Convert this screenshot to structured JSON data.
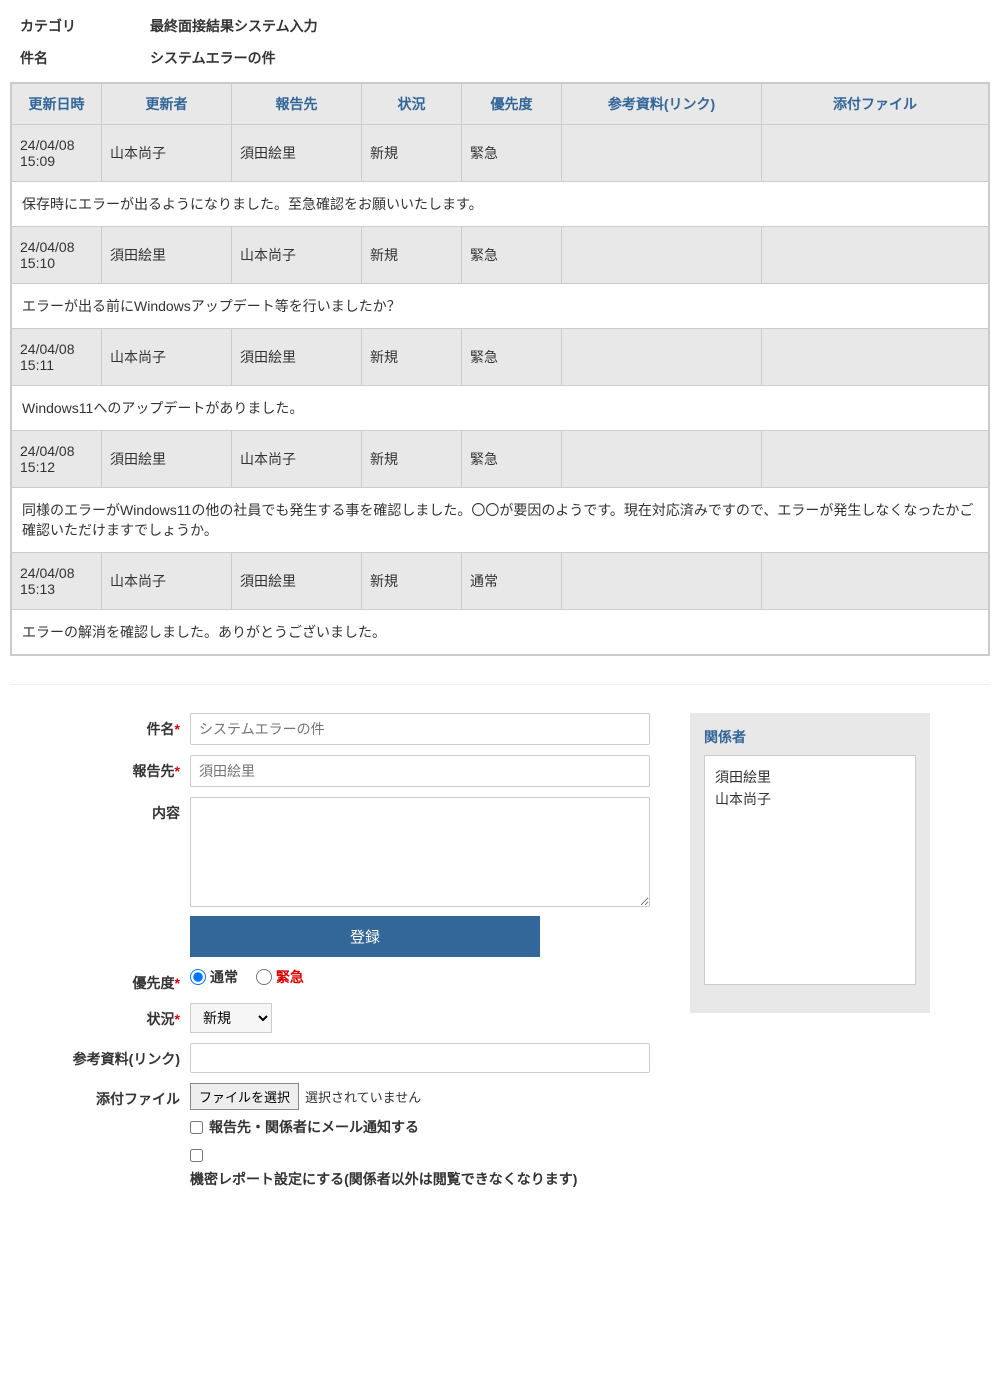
{
  "header": {
    "category_label": "カテゴリ",
    "category_value": "最終面接結果システム入力",
    "subject_label": "件名",
    "subject_value": "システムエラーの件"
  },
  "table": {
    "headers": {
      "date": "更新日時",
      "updater": "更新者",
      "report_to": "報告先",
      "status": "状況",
      "priority": "優先度",
      "reference": "参考資料(リンク)",
      "attachment": "添付ファイル"
    },
    "rows": [
      {
        "date": "24/04/08 15:09",
        "updater": "山本尚子",
        "report_to": "須田絵里",
        "status": "新規",
        "priority": "緊急",
        "reference": "",
        "attachment": "",
        "message": "保存時にエラーが出るようになりました。至急確認をお願いいたします。"
      },
      {
        "date": "24/04/08 15:10",
        "updater": "須田絵里",
        "report_to": "山本尚子",
        "status": "新規",
        "priority": "緊急",
        "reference": "",
        "attachment": "",
        "message": "エラーが出る前にWindowsアップデート等を行いましたか？"
      },
      {
        "date": "24/04/08 15:11",
        "updater": "山本尚子",
        "report_to": "須田絵里",
        "status": "新規",
        "priority": "緊急",
        "reference": "",
        "attachment": "",
        "message": "Windows11へのアップデートがありました。"
      },
      {
        "date": "24/04/08 15:12",
        "updater": "須田絵里",
        "report_to": "山本尚子",
        "status": "新規",
        "priority": "緊急",
        "reference": "",
        "attachment": "",
        "message": "同様のエラーがWindows11の他の社員でも発生する事を確認しました。〇〇が要因のようです。現在対応済みですので、エラーが発生しなくなったかご確認いただけますでしょうか。"
      },
      {
        "date": "24/04/08 15:13",
        "updater": "山本尚子",
        "report_to": "須田絵里",
        "status": "新規",
        "priority": "通常",
        "reference": "",
        "attachment": "",
        "message": "エラーの解消を確認しました。ありがとうございました。"
      }
    ]
  },
  "form": {
    "labels": {
      "subject": "件名",
      "report_to": "報告先",
      "content": "内容",
      "priority": "優先度",
      "status": "状況",
      "reference": "参考資料(リンク)",
      "attachment": "添付ファイル"
    },
    "values": {
      "subject_placeholder": "システムエラーの件",
      "report_to_placeholder": "須田絵里",
      "submit": "登録",
      "priority_normal": "通常",
      "priority_urgent": "緊急",
      "status_selected": "新規",
      "file_button": "ファイルを選択",
      "file_none": "選択されていません",
      "notify_label": "報告先・関係者にメール通知する",
      "confidential_label": "機密レポート設定にする(関係者以外は閲覧できなくなります)"
    }
  },
  "side": {
    "title": "関係者",
    "members": [
      "須田絵里",
      "山本尚子"
    ]
  }
}
